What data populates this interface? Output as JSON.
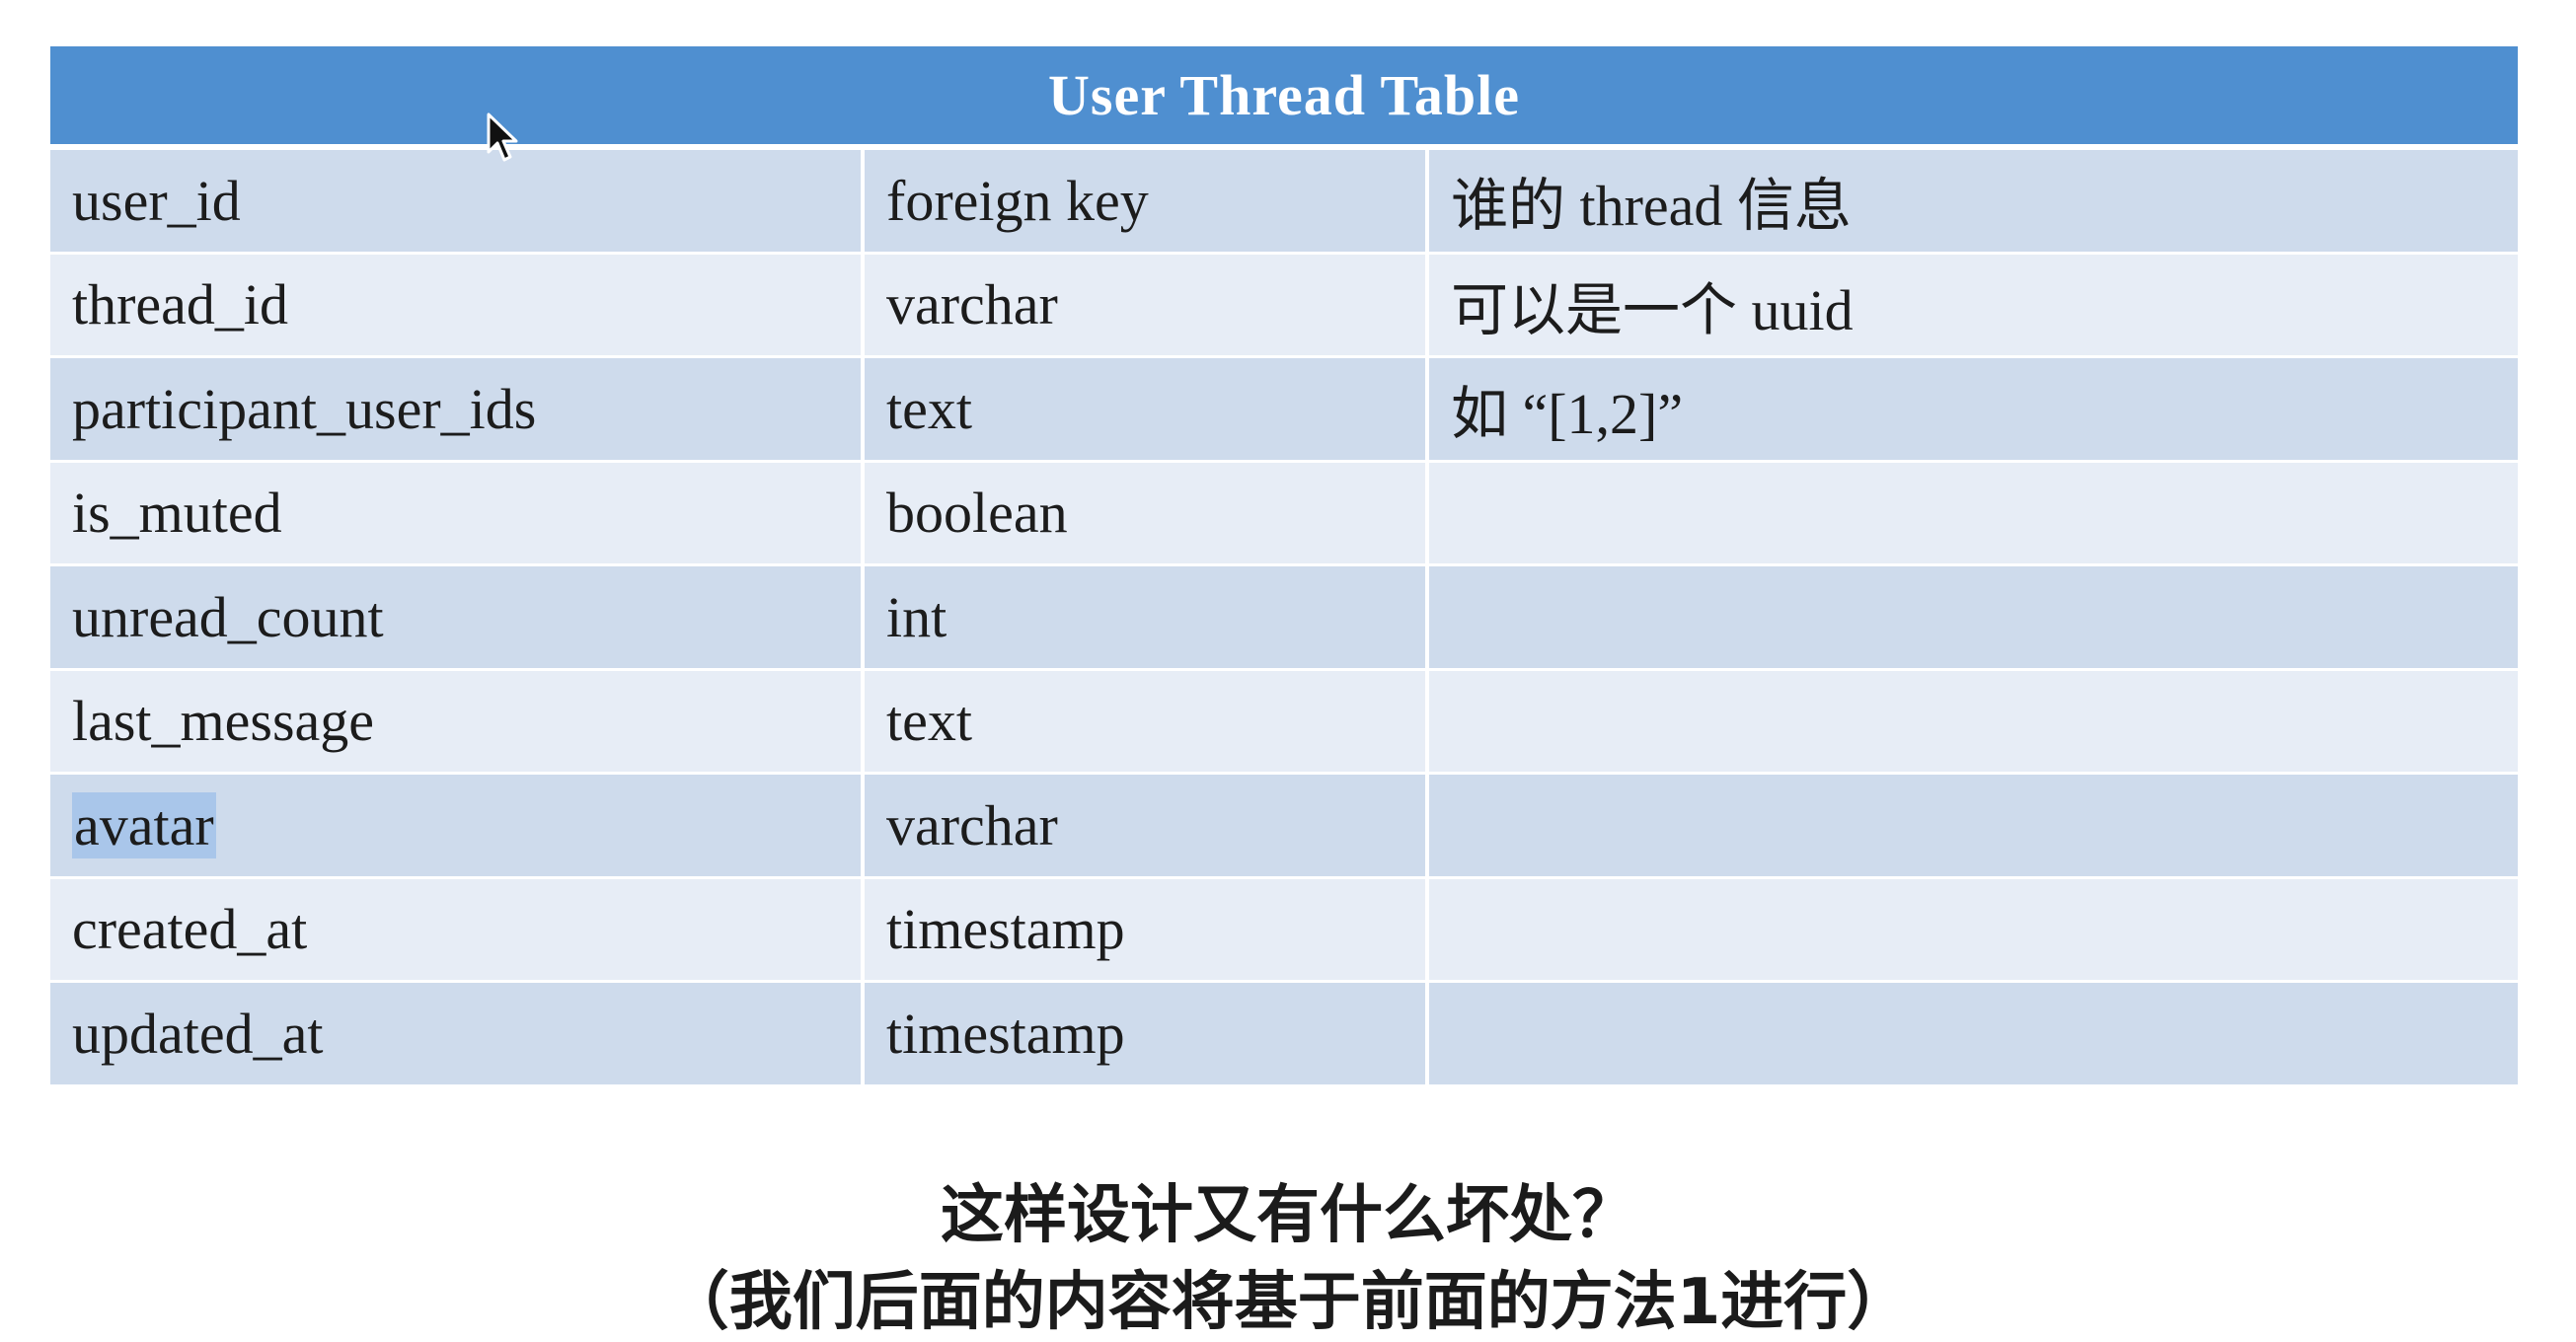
{
  "table": {
    "title": "User Thread Table",
    "rows": [
      {
        "field": "user_id",
        "type": "foreign key",
        "note": "谁的 thread 信息"
      },
      {
        "field": "thread_id",
        "type": "varchar",
        "note": "可以是一个 uuid"
      },
      {
        "field": "participant_user_ids",
        "type": "text",
        "note": "如 “[1,2]”"
      },
      {
        "field": "is_muted",
        "type": "boolean",
        "note": ""
      },
      {
        "field": "unread_count",
        "type": "int",
        "note": ""
      },
      {
        "field": "last_message",
        "type": "text",
        "note": ""
      },
      {
        "field": "avatar",
        "type": "varchar",
        "note": ""
      },
      {
        "field": "created_at",
        "type": "timestamp",
        "note": ""
      },
      {
        "field": "updated_at",
        "type": "timestamp",
        "note": ""
      }
    ]
  },
  "captions": {
    "line1": "这样设计又有什么坏处？",
    "line2": "（我们后面的内容将基于前面的方法1进行）"
  },
  "colors": {
    "header": "#4f8fd0",
    "row_odd": "#cedbec",
    "row_even": "#e7edf6",
    "selection": "#a9c6ea"
  },
  "icons": {
    "cursor": "mouse-pointer-icon"
  }
}
